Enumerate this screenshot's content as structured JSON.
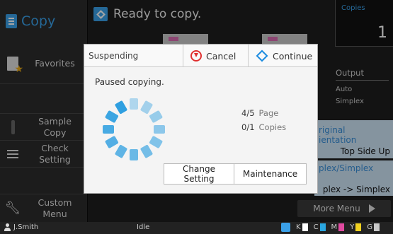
{
  "app": {
    "title": "Copy",
    "icon": "copy-doc-icon"
  },
  "status": {
    "text": "Ready to copy.",
    "icon": "ready-diamond-icon"
  },
  "copies": {
    "label": "Copies",
    "value": "1"
  },
  "sidebar": {
    "items": [
      {
        "label": "Favorites",
        "icon": "star-document-icon"
      },
      {
        "label": "Sample\nCopy",
        "icon": "sample-copy-icon"
      },
      {
        "label": "Check\nSetting",
        "icon": "list-icon"
      },
      {
        "label": "Custom\nMenu",
        "icon": "wrench-icon"
      }
    ]
  },
  "right_panel": {
    "output_label": "Output",
    "output_values": [
      "Auto",
      "Simplex"
    ],
    "orientation_label": "Original Orientation",
    "orientation_label_visible": "riginal\nientation",
    "orientation_value": "Top Side Up",
    "duplex_label_visible": "plex/Simplex",
    "duplex_value_visible": "plex -> Simplex",
    "more_menu_label": "More Menu"
  },
  "dialog": {
    "title": "Suspending",
    "cancel_label": "Cancel",
    "continue_label": "Continue",
    "message": "Paused copying.",
    "pages": {
      "value": "4/5",
      "unit": "Page"
    },
    "copies": {
      "value": "0/1",
      "unit": "Copies"
    },
    "change_setting_label": "Change Setting",
    "maintenance_label": "Maintenance"
  },
  "statusbar": {
    "user": "J.Smith",
    "state": "Idle",
    "toners": [
      {
        "label": "K",
        "color": "#ffffff"
      },
      {
        "label": "C",
        "color": "#2aa6e0"
      },
      {
        "label": "M",
        "color": "#e04aa0"
      },
      {
        "label": "Y",
        "color": "#f0d020"
      },
      {
        "label": "G",
        "color": "#c8c8c8"
      }
    ]
  },
  "colors": {
    "accent": "#3aa0e8",
    "spinner": "#2f9fe0",
    "panel": "#cde3f5"
  }
}
